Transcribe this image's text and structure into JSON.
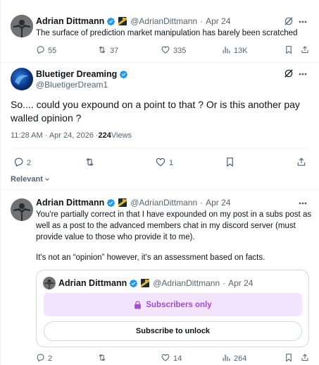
{
  "tweet1": {
    "author_name": "Adrian Dittmann",
    "handle": "@AdrianDittmann",
    "separator": "·",
    "date": "Apr 24",
    "text": "The surface of prediction market manipulation has barely been scratched",
    "reply_count": "55",
    "retweet_count": "37",
    "like_count": "335",
    "view_count": "13K"
  },
  "reply": {
    "author_name": "Bluetiger Dreaming",
    "handle": "@BluetigerDream1",
    "text": "So.... could you expound on a point to that ? Or is this another pay walled opinion ?",
    "timestamp": "11:28 AM · Apr 24, 2026 · ",
    "views_number": "224",
    "views_label": " Views",
    "reply_count": "2",
    "like_count": "1"
  },
  "sort": {
    "label": "Relevant"
  },
  "tweet3": {
    "author_name": "Adrian Dittmann",
    "handle": "@AdrianDittmann",
    "separator": "·",
    "date": "Apr 24",
    "text_p1": "You're partially correct in that I have expounded on my post in a subs post as well as a post to the advanced members chat in my discord server (must provide value to those who provide it to me).",
    "text_p2": "It's not an “opinion” however, it's an assessment based on facts.",
    "quote": {
      "author_name": "Adrian Dittmann",
      "handle": "@AdrianDittmann",
      "separator": "·",
      "date": "Apr 24",
      "subscribers_only": "Subscribers only",
      "subscribe_button": "Subscribe to unlock"
    },
    "reply_count": "2",
    "retweet_count": "",
    "like_count": "14",
    "view_count": "264"
  },
  "colors": {
    "verified": "#1d9bf0",
    "subscribe_bg": "#f4e5fe",
    "subscribe_text": "#a34ad6",
    "muted": "#536471"
  },
  "icons": [
    "verified-badge-icon",
    "grok-icon",
    "more-icon",
    "reply-icon",
    "retweet-icon",
    "like-icon",
    "views-icon",
    "bookmark-icon",
    "share-icon",
    "lock-icon",
    "chevron-down-icon"
  ]
}
